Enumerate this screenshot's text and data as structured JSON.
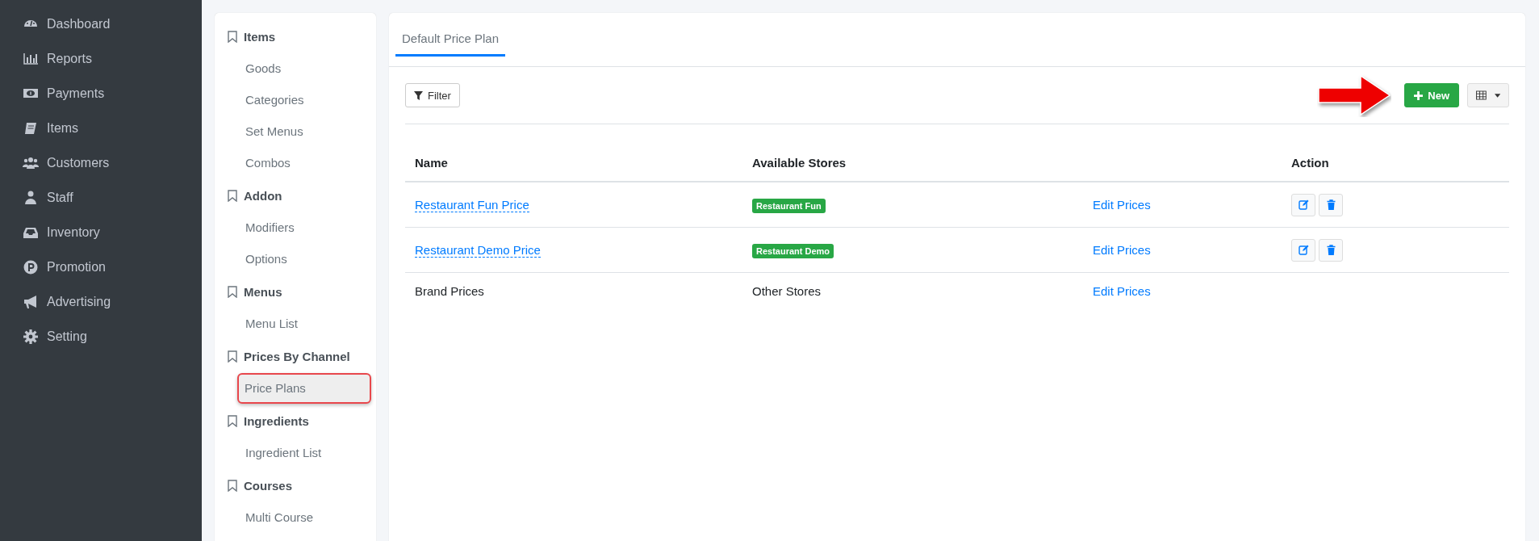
{
  "sidebar": {
    "items": [
      {
        "label": "Dashboard",
        "selected": false
      },
      {
        "label": "Reports",
        "selected": false
      },
      {
        "label": "Payments",
        "selected": false
      },
      {
        "label": "Items",
        "selected": false
      },
      {
        "label": "Customers",
        "selected": false
      },
      {
        "label": "Staff",
        "selected": false
      },
      {
        "label": "Inventory",
        "selected": false
      },
      {
        "label": "Promotion",
        "selected": false
      },
      {
        "label": "Advertising",
        "selected": false
      },
      {
        "label": "Setting",
        "selected": false
      }
    ]
  },
  "submenu": {
    "sections": [
      {
        "title": "Items",
        "items": [
          {
            "label": "Goods",
            "selected": false
          },
          {
            "label": "Categories",
            "selected": false
          },
          {
            "label": "Set Menus",
            "selected": false
          },
          {
            "label": "Combos",
            "selected": false
          }
        ]
      },
      {
        "title": "Addon",
        "items": [
          {
            "label": "Modifiers",
            "selected": false
          },
          {
            "label": "Options",
            "selected": false
          }
        ]
      },
      {
        "title": "Menus",
        "items": [
          {
            "label": "Menu List",
            "selected": false
          }
        ]
      },
      {
        "title": "Prices By Channel",
        "items": [
          {
            "label": "Price Plans",
            "selected": true
          }
        ]
      },
      {
        "title": "Ingredients",
        "items": [
          {
            "label": "Ingredient List",
            "selected": false
          }
        ]
      },
      {
        "title": "Courses",
        "items": [
          {
            "label": "Multi Course",
            "selected": false
          }
        ]
      }
    ]
  },
  "tabs": [
    {
      "label": "Default Price Plan",
      "selected": true
    }
  ],
  "toolbar": {
    "filter_button": "Filter",
    "new_button": "New"
  },
  "table": {
    "columns": [
      "Name",
      "Available Stores",
      "Action"
    ],
    "rows": [
      {
        "name": {
          "text": "Restaurant Fun Price",
          "kind": "link"
        },
        "store": {
          "text": "Restaurant Fun",
          "kind": "badge"
        },
        "edit": "Edit Prices",
        "actions": true
      },
      {
        "name": {
          "text": "Restaurant Demo Price",
          "kind": "link"
        },
        "store": {
          "text": "Restaurant Demo",
          "kind": "badge"
        },
        "edit": "Edit Prices",
        "actions": true
      },
      {
        "name": {
          "text": "Brand Prices",
          "kind": "plain"
        },
        "store": {
          "text": "Other Stores",
          "kind": "plain"
        },
        "edit": "Edit Prices",
        "actions": false
      }
    ]
  }
}
